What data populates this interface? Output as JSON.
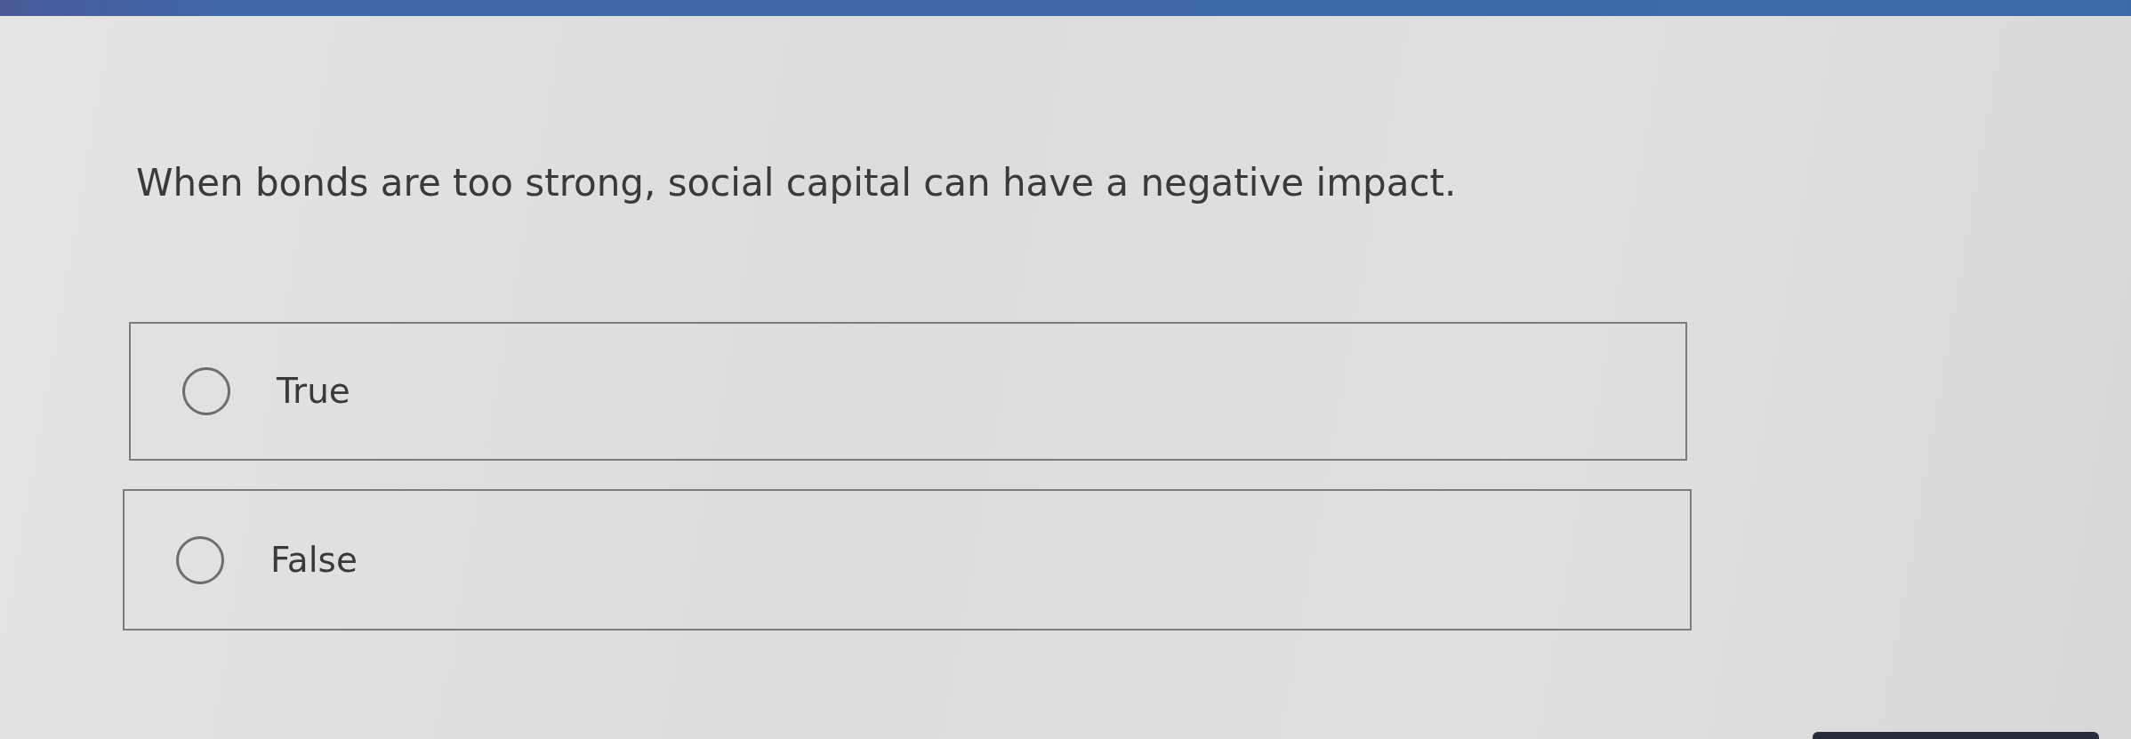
{
  "question": {
    "text": "When bonds are too strong, social capital can have a negative impact."
  },
  "options": [
    {
      "label": "True",
      "selected": false
    },
    {
      "label": "False",
      "selected": false
    }
  ]
}
